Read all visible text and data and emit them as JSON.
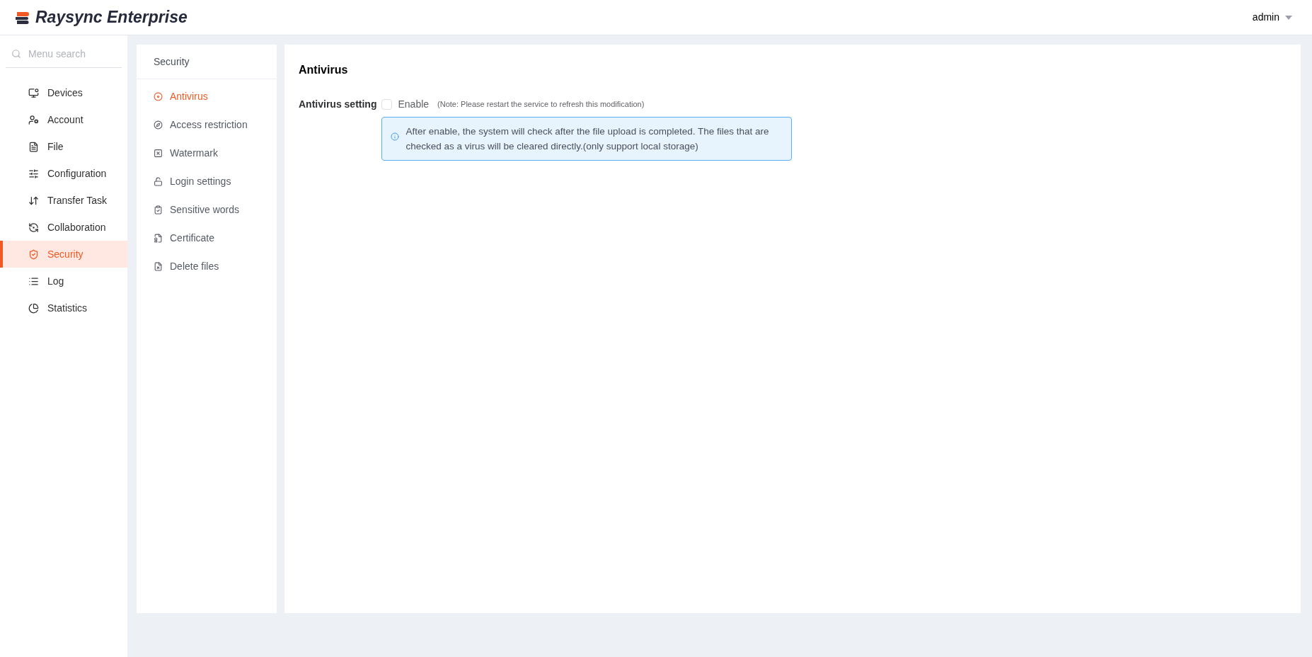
{
  "header": {
    "brand": "Raysync Enterprise",
    "user": "admin"
  },
  "sidebar": {
    "search": {
      "placeholder": "Menu search"
    },
    "items": [
      {
        "kind": "devices",
        "label": "Devices",
        "selected": false
      },
      {
        "kind": "account",
        "label": "Account",
        "selected": false
      },
      {
        "kind": "file",
        "label": "File",
        "selected": false
      },
      {
        "kind": "configuration",
        "label": "Configuration",
        "selected": false
      },
      {
        "kind": "transfer",
        "label": "Transfer Task",
        "selected": false
      },
      {
        "kind": "collaboration",
        "label": "Collaboration",
        "selected": false
      },
      {
        "kind": "security",
        "label": "Security",
        "selected": true
      },
      {
        "kind": "log",
        "label": "Log",
        "selected": false
      },
      {
        "kind": "statistics",
        "label": "Statistics",
        "selected": false
      }
    ]
  },
  "submenu": {
    "title": "Security",
    "items": [
      {
        "kind": "antivirus",
        "label": "Antivirus",
        "selected": true
      },
      {
        "kind": "access",
        "label": "Access restriction",
        "selected": false
      },
      {
        "kind": "watermark",
        "label": "Watermark",
        "selected": false
      },
      {
        "kind": "login",
        "label": "Login settings",
        "selected": false
      },
      {
        "kind": "sensitive",
        "label": "Sensitive words",
        "selected": false
      },
      {
        "kind": "certificate",
        "label": "Certificate",
        "selected": false
      },
      {
        "kind": "delete",
        "label": "Delete files",
        "selected": false
      }
    ]
  },
  "content": {
    "title": "Antivirus",
    "setting": {
      "label": "Antivirus setting",
      "checkbox_label": "Enable",
      "checked": false,
      "note": "(Note: Please restart the service to refresh this modification)",
      "info": "After enable, the system will check after the file upload is completed. The files that are checked as a virus will be cleared directly.(only support local storage)"
    }
  }
}
